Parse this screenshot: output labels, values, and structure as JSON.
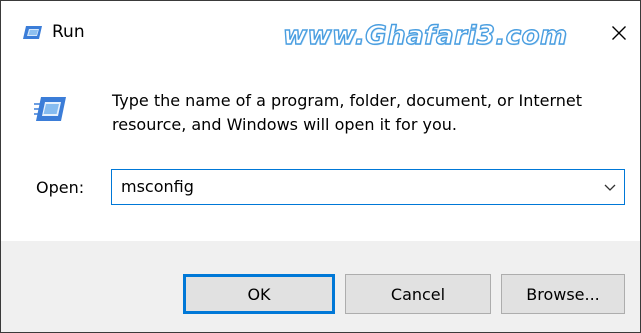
{
  "window": {
    "title": "Run",
    "watermark": "www.Ghafari3.com",
    "close_glyph": "✕"
  },
  "content": {
    "description": "Type the name of a program, folder, document, or Internet resource, and Windows will open it for you.",
    "open_label": "Open:",
    "input_value": "msconfig"
  },
  "buttons": {
    "ok": "OK",
    "cancel": "Cancel",
    "browse": "Browse..."
  },
  "icons": {
    "title": "run-icon",
    "big": "run-icon-large",
    "close": "close-icon",
    "dropdown": "chevron-down-icon"
  },
  "colors": {
    "accent": "#0078d7",
    "icon_blue": "#3b7dd8",
    "footer_bg": "#f0f0f0"
  }
}
